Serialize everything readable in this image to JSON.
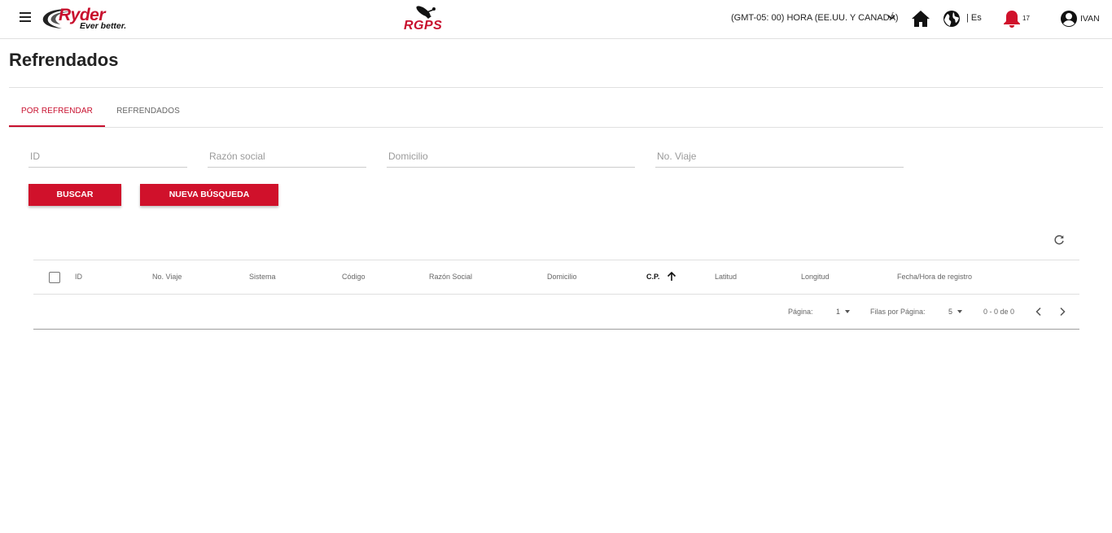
{
  "header": {
    "brand": "Ryder",
    "tagline": "Ever better.",
    "product": "RGPS",
    "timezone": "(GMT-05: 00) HORA (EE.UU. Y CANADÁ)",
    "language": "| Es",
    "notification_count": "17",
    "user": "IVAN",
    "icons": [
      "menu-icon",
      "home-icon",
      "globe-icon",
      "bell-icon",
      "account-circle-icon",
      "chevron-down-icon"
    ],
    "accent_color": "#c8102e"
  },
  "page": {
    "title": "Refrendados"
  },
  "tabs": [
    {
      "label": "POR REFRENDAR",
      "active": true
    },
    {
      "label": "REFRENDADOS",
      "active": false
    }
  ],
  "filters": {
    "id_placeholder": "ID",
    "razon_placeholder": "Razón social",
    "domicilio_placeholder": "Domicilio",
    "viaje_placeholder": "No. Viaje"
  },
  "buttons": {
    "search": "BUSCAR",
    "new_search": "NUEVA BÚSQUEDA"
  },
  "table": {
    "columns": [
      "ID",
      "No. Viaje",
      "Sistema",
      "Código",
      "Razón Social",
      "Domicilio",
      "C.P.",
      "Latitud",
      "Longitud",
      "Fecha/Hora de registro"
    ],
    "sorted_column": "C.P.",
    "sort_direction": "asc",
    "rows": []
  },
  "pagination": {
    "page_label": "Página:",
    "page_value": "1",
    "rows_label": "Filas por Página:",
    "rows_value": "5",
    "range": "0 - 0 de 0"
  }
}
